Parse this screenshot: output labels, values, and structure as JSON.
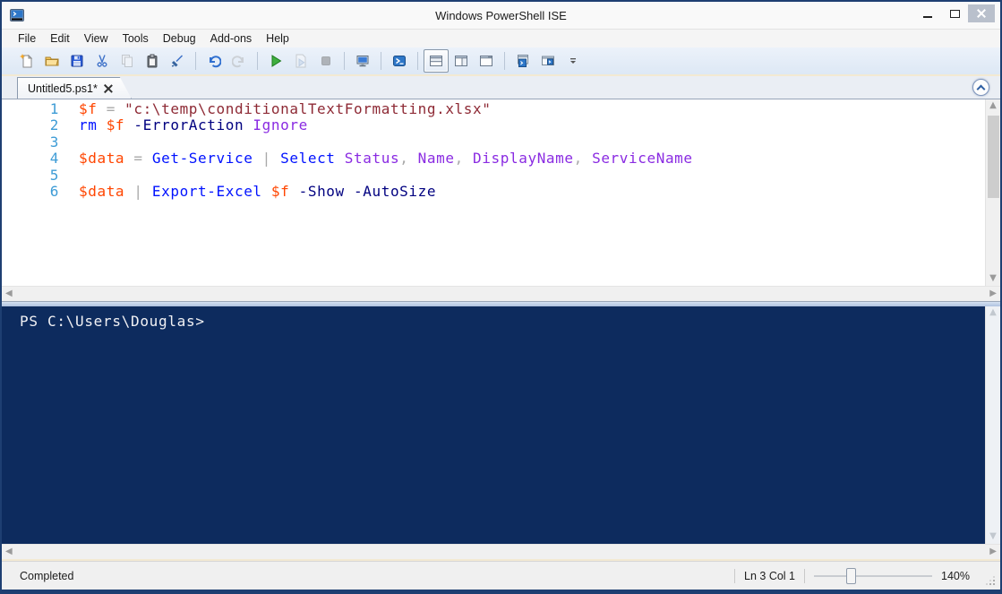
{
  "window": {
    "title": "Windows PowerShell ISE"
  },
  "menu": {
    "items": [
      "File",
      "Edit",
      "View",
      "Tools",
      "Debug",
      "Add-ons",
      "Help"
    ]
  },
  "toolbar": {
    "buttons": [
      {
        "name": "new-script",
        "icon": "new-script-icon",
        "enabled": true
      },
      {
        "name": "open-script",
        "icon": "open-folder-icon",
        "enabled": true
      },
      {
        "name": "save-script",
        "icon": "save-icon",
        "enabled": true
      },
      {
        "name": "cut",
        "icon": "cut-icon",
        "enabled": true
      },
      {
        "name": "copy",
        "icon": "copy-icon",
        "enabled": false
      },
      {
        "name": "paste",
        "icon": "paste-icon",
        "enabled": true
      },
      {
        "name": "clear-console-pane",
        "icon": "clear-icon",
        "enabled": true
      },
      {
        "sep": true
      },
      {
        "name": "undo",
        "icon": "undo-icon",
        "enabled": true
      },
      {
        "name": "redo",
        "icon": "redo-icon",
        "enabled": false
      },
      {
        "sep": true
      },
      {
        "name": "run-script",
        "icon": "run-icon",
        "enabled": true
      },
      {
        "name": "run-selection",
        "icon": "run-selection-icon",
        "enabled": false
      },
      {
        "name": "stop-operation",
        "icon": "stop-icon",
        "enabled": false
      },
      {
        "sep": true
      },
      {
        "name": "new-remote-powershell-tab",
        "icon": "remote-tab-icon",
        "enabled": true
      },
      {
        "sep": true
      },
      {
        "name": "start-powershell",
        "icon": "powershell-icon",
        "enabled": true
      },
      {
        "sep": true
      },
      {
        "name": "show-script-pane-top",
        "icon": "script-pane-top-icon",
        "enabled": true,
        "selected": true
      },
      {
        "name": "show-script-pane-right",
        "icon": "script-pane-right-icon",
        "enabled": true
      },
      {
        "name": "show-script-pane-maximized",
        "icon": "script-pane-maximized-icon",
        "enabled": true
      },
      {
        "sep": true
      },
      {
        "name": "new-powershell-tab",
        "icon": "powershell-tab-icon",
        "enabled": true
      },
      {
        "name": "show-command-window",
        "icon": "powershell-window-icon",
        "enabled": true
      },
      {
        "name": "toolbar-overflow",
        "icon": "overflow-icon",
        "enabled": true
      }
    ]
  },
  "tab": {
    "label": "Untitled5.ps1*"
  },
  "editor": {
    "lines": [
      {
        "no": "1",
        "tokens": [
          [
            "var",
            "$f"
          ],
          [
            "op",
            " = "
          ],
          [
            "str",
            "\"c:\\temp\\conditionalTextFormatting.xlsx\""
          ]
        ]
      },
      {
        "no": "2",
        "tokens": [
          [
            "cmd",
            "rm"
          ],
          [
            "var",
            " $f"
          ],
          [
            "param",
            " -ErrorAction"
          ],
          [
            "arg",
            " Ignore"
          ]
        ]
      },
      {
        "no": "3",
        "tokens": []
      },
      {
        "no": "4",
        "tokens": [
          [
            "var",
            "$data"
          ],
          [
            "op",
            " = "
          ],
          [
            "cmd",
            "Get-Service"
          ],
          [
            "op",
            " | "
          ],
          [
            "cmd",
            "Select"
          ],
          [
            "arg",
            " Status"
          ],
          [
            "op",
            ","
          ],
          [
            "arg",
            " Name"
          ],
          [
            "op",
            ","
          ],
          [
            "arg",
            " DisplayName"
          ],
          [
            "op",
            ","
          ],
          [
            "arg",
            " ServiceName"
          ]
        ]
      },
      {
        "no": "5",
        "tokens": []
      },
      {
        "no": "6",
        "tokens": [
          [
            "var",
            "$data"
          ],
          [
            "op",
            " | "
          ],
          [
            "cmd",
            "Export-Excel"
          ],
          [
            "var",
            " $f"
          ],
          [
            "param",
            " -Show"
          ],
          [
            "param",
            " -AutoSize"
          ]
        ]
      }
    ]
  },
  "console": {
    "prompt": "PS C:\\Users\\Douglas>"
  },
  "statusbar": {
    "status": "Completed",
    "position": "Ln 3 Col 1",
    "zoom": "140%"
  },
  "colors": {
    "window_border": "#1E3F72",
    "console_bg": "#0D2B5E",
    "console_fg": "#F1F1F4",
    "syntax": {
      "var": "#FF4500",
      "op": "#A9A9A9",
      "str": "#8E2A35",
      "cmd": "#0012FF",
      "param": "#000080",
      "arg": "#8A2BE2",
      "lineno": "#3E9CD6"
    }
  }
}
